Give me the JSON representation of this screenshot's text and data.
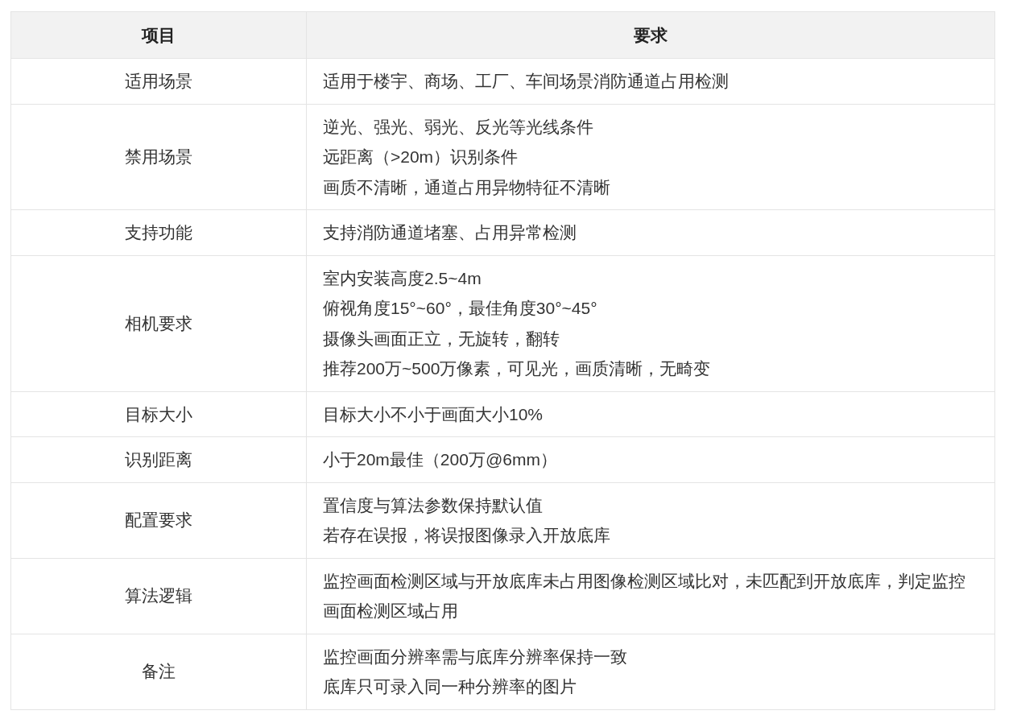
{
  "table": {
    "columns": [
      "项目",
      "要求"
    ],
    "rows": [
      {
        "item": "适用场景",
        "requirements": [
          "适用于楼宇、商场、工厂、车间场景消防通道占用检测"
        ]
      },
      {
        "item": "禁用场景",
        "requirements": [
          "逆光、强光、弱光、反光等光线条件",
          "远距离（>20m）识别条件",
          "画质不清晰，通道占用异物特征不清晰"
        ]
      },
      {
        "item": "支持功能",
        "requirements": [
          "支持消防通道堵塞、占用异常检测"
        ]
      },
      {
        "item": "相机要求",
        "requirements": [
          "室内安装高度2.5~4m",
          "俯视角度15°~60°，最佳角度30°~45°",
          "摄像头画面正立，无旋转，翻转",
          "推荐200万~500万像素，可见光，画质清晰，无畸变"
        ]
      },
      {
        "item": "目标大小",
        "requirements": [
          "目标大小不小于画面大小10%"
        ]
      },
      {
        "item": "识别距离",
        "requirements": [
          "小于20m最佳（200万@6mm）"
        ]
      },
      {
        "item": "配置要求",
        "requirements": [
          "置信度与算法参数保持默认值",
          "若存在误报，将误报图像录入开放底库"
        ]
      },
      {
        "item": "算法逻辑",
        "requirements": [
          "监控画面检测区域与开放底库未占用图像检测区域比对，未匹配到开放底库，判定监控画面检测区域占用"
        ]
      },
      {
        "item": "备注",
        "requirements": [
          "监控画面分辨率需与底库分辨率保持一致",
          "底库只可录入同一种分辨率的图片"
        ]
      }
    ]
  }
}
